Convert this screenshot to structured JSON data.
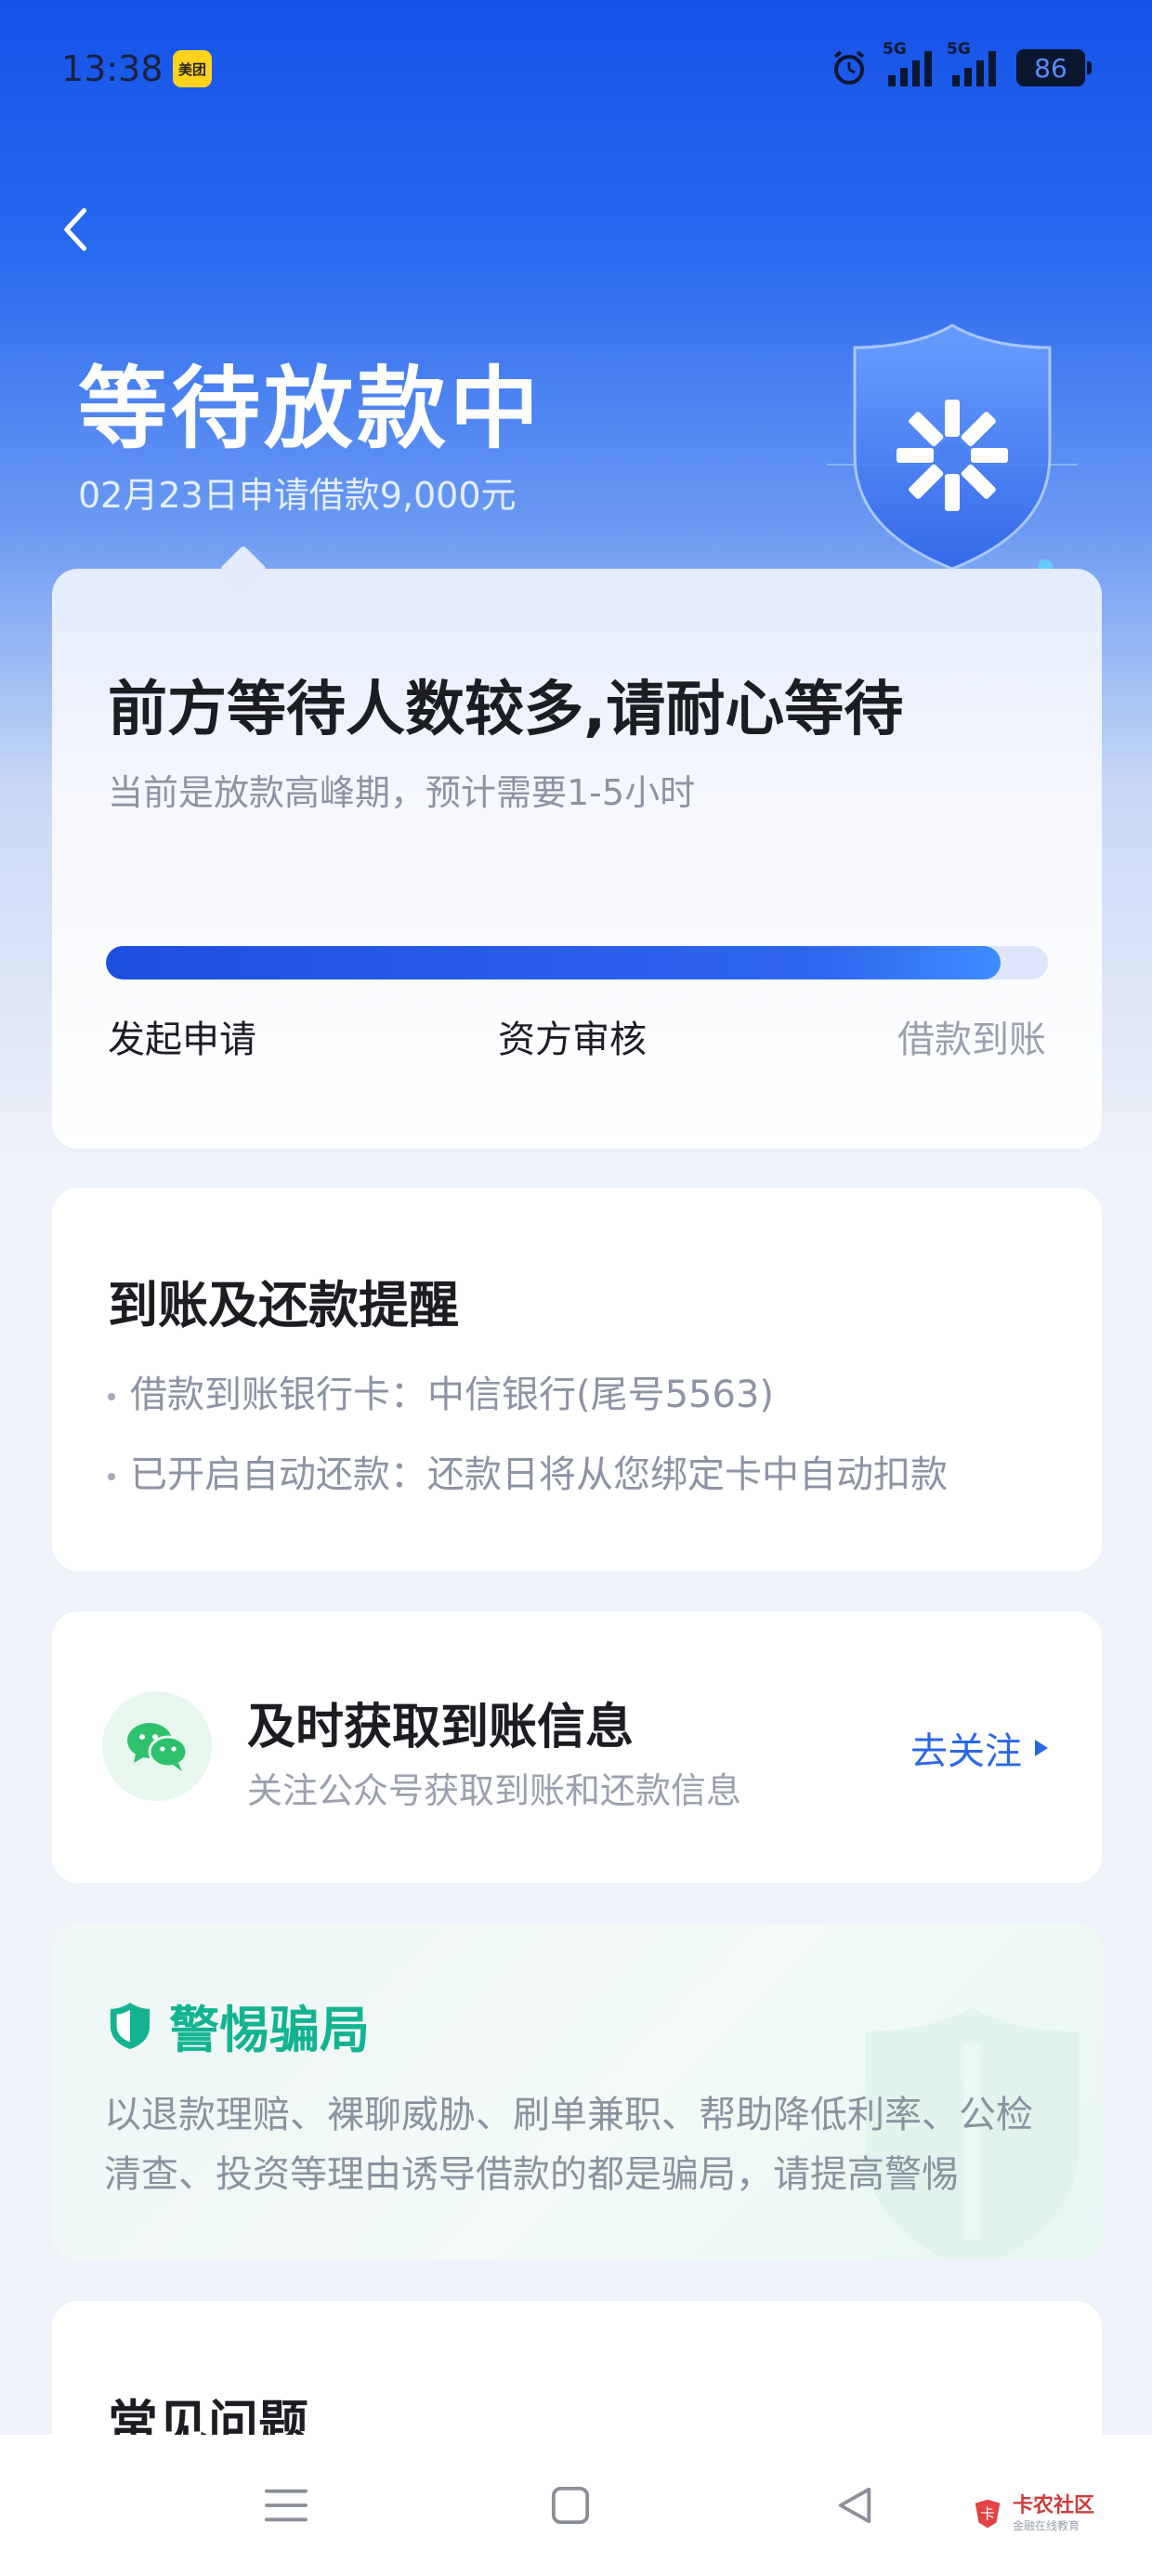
{
  "status_bar": {
    "time": "13:38",
    "app_badge": "美团",
    "signal_1_label": "5G",
    "signal_2_label": "5G",
    "battery": "86"
  },
  "header": {
    "title": "等待放款中",
    "subtitle": "02月23日申请借款9,000元"
  },
  "status_card": {
    "heading": "前方等待人数较多,请耐心等待",
    "description": "当前是放款高峰期，预计需要1-5小时",
    "progress_percent": 95,
    "steps": [
      "发起申请",
      "资方审核",
      "借款到账"
    ]
  },
  "reminder_card": {
    "title": "到账及还款提醒",
    "items": [
      "借款到账银行卡：中信银行(尾号5563)",
      "已开启自动还款：还款日将从您绑定卡中自动扣款"
    ]
  },
  "follow_card": {
    "title": "及时获取到账信息",
    "description": "关注公众号获取到账和还款信息",
    "link_label": "去关注"
  },
  "fraud_card": {
    "title": "警惕骗局",
    "text": "以退款理赔、裸聊威胁、刷单兼职、帮助降低利率、公检清查、投资等理由诱导借款的都是骗局，请提高警惕"
  },
  "faq_card": {
    "title": "常见问题"
  },
  "watermark": {
    "name": "卡农社区",
    "sub": "金融在线教育"
  },
  "colors": {
    "primary_blue": "#1552e8",
    "link_blue": "#2a67e6",
    "fraud_green": "#13b392",
    "wechat_green": "#2dc16b"
  },
  "icons": [
    "back-arrow-icon",
    "alarm-icon",
    "signal-icon",
    "battery-icon",
    "bank-shield-icon",
    "wechat-icon",
    "shield-icon",
    "menu-icon",
    "home-icon",
    "back-icon"
  ]
}
